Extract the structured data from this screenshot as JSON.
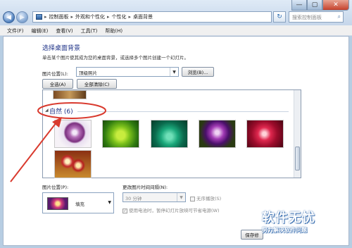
{
  "window": {
    "minimize_glyph": "—",
    "maximize_glyph": "▢",
    "close_glyph": "✕"
  },
  "address_bar": {
    "back_glyph": "◀",
    "forward_glyph": "▶",
    "breadcrumb": [
      "控制面板",
      "外观和个性化",
      "个性化",
      "桌面背景"
    ],
    "separator": "▸",
    "refresh_glyph": "↻",
    "search_placeholder": "搜索控制面板"
  },
  "menu": [
    "文件(F)",
    "编辑(E)",
    "查看(V)",
    "工具(T)",
    "帮助(H)"
  ],
  "page": {
    "title": "选择桌面背景",
    "description": "单击某个图片使其成为您的桌面背景，或选择多个图片创建一个幻灯片。",
    "picture_location_label": "图片位置(L):",
    "picture_location_value": "顶级照片",
    "browse_label": "浏览(B)...",
    "select_all_label": "全选(A)",
    "clear_all_label": "全部清除(C)"
  },
  "gallery": {
    "section_title": "自然 (6)",
    "thumbnails": [
      "flower-purple-icon",
      "leaf-green-icon",
      "plant-teal-icon",
      "flower-violet-icon",
      "flower-red-icon",
      "flower-bouquet-icon"
    ]
  },
  "bottom": {
    "position_label": "图片位置(P):",
    "position_value": "填充",
    "interval_label": "更改图片时间间隔(N):",
    "interval_value": "30 分钟",
    "shuffle_label": "无序播放(S)",
    "battery_label": "使用电池时，暂停幻灯片放映可节省电源(W)",
    "save_label": "保存修"
  },
  "watermark": {
    "title": "软件无忧",
    "subtitle": "努力解决软件问题"
  },
  "colors": {
    "accent": "#1e3287",
    "annotation": "#d93a2e"
  }
}
